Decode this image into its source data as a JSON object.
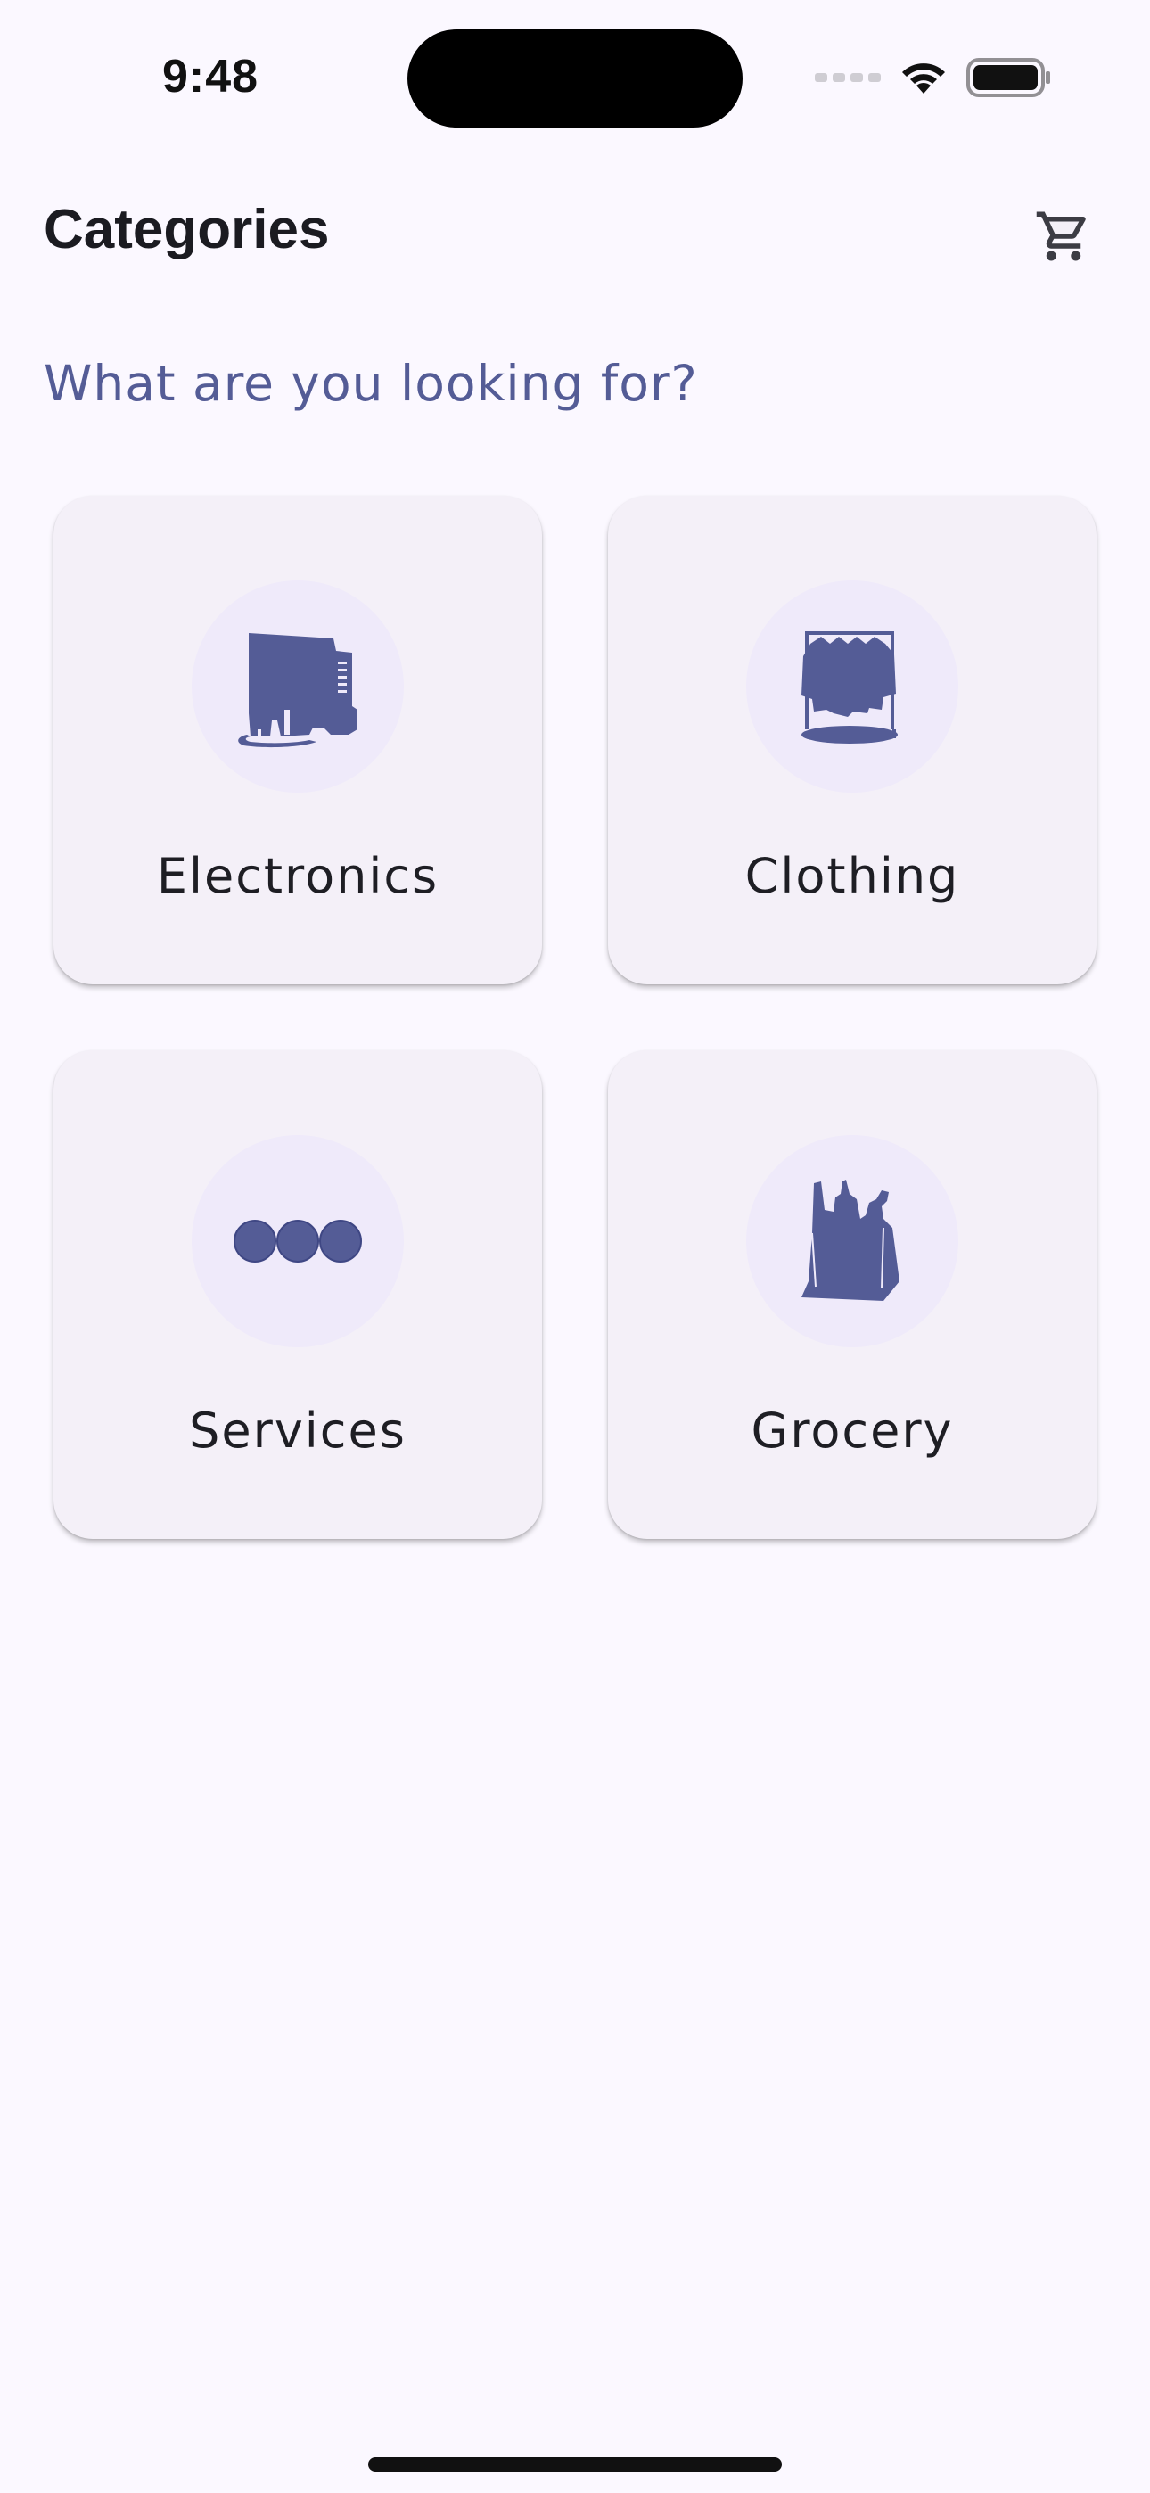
{
  "status_bar": {
    "time": "9:48",
    "icons": [
      "signal-icon",
      "wifi-icon",
      "battery-icon"
    ]
  },
  "header": {
    "title": "Categories",
    "cart_icon": "shopping-cart-icon"
  },
  "subtitle": "What are you looking for?",
  "categories": [
    {
      "label": "Electronics",
      "icon": "electronics-icon"
    },
    {
      "label": "Clothing",
      "icon": "clothing-rack-icon"
    },
    {
      "label": "Services",
      "icon": "more-dots-icon"
    },
    {
      "label": "Grocery",
      "icon": "grocery-bag-icon"
    }
  ],
  "colors": {
    "background": "#fbf8ff",
    "accent": "#545c96",
    "card": "#f4f0f8",
    "icon_circle": "#efeafa",
    "text": "#1b1b21"
  }
}
